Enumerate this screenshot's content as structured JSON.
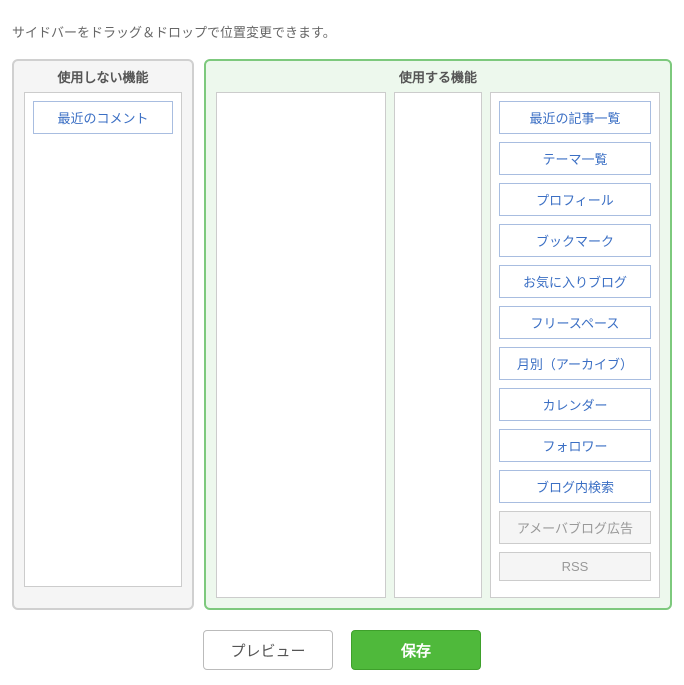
{
  "instruction": "サイドバーをドラッグ＆ドロップで位置変更できます。",
  "panels": {
    "unused": {
      "title": "使用しない機能"
    },
    "used": {
      "title": "使用する機能"
    }
  },
  "unused_items": [
    {
      "label": "最近のコメント",
      "disabled": false
    }
  ],
  "used_items": [
    {
      "label": "最近の記事一覧",
      "disabled": false
    },
    {
      "label": "テーマ一覧",
      "disabled": false
    },
    {
      "label": "プロフィール",
      "disabled": false
    },
    {
      "label": "ブックマーク",
      "disabled": false
    },
    {
      "label": "お気に入りブログ",
      "disabled": false
    },
    {
      "label": "フリースペース",
      "disabled": false
    },
    {
      "label": "月別（アーカイブ）",
      "disabled": false
    },
    {
      "label": "カレンダー",
      "disabled": false
    },
    {
      "label": "フォロワー",
      "disabled": false
    },
    {
      "label": "ブログ内検索",
      "disabled": false
    },
    {
      "label": "アメーバブログ広告",
      "disabled": true
    },
    {
      "label": "RSS",
      "disabled": true
    }
  ],
  "buttons": {
    "preview": "プレビュー",
    "save": "保存"
  }
}
